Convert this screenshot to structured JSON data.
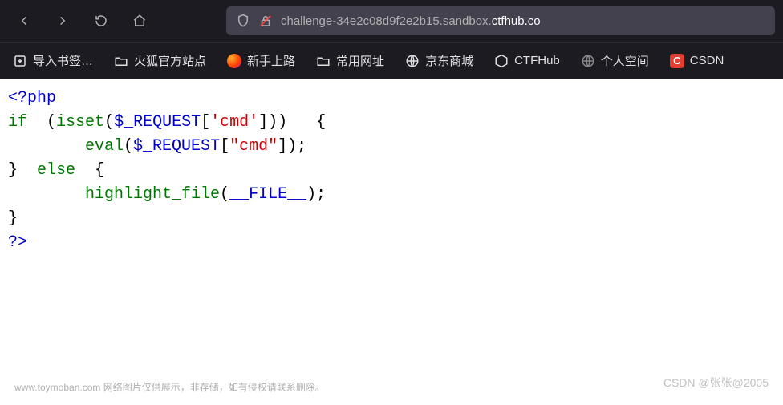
{
  "nav": {
    "url_prefix": "challenge-34e2c08d9f2e2b15.sandbox.",
    "url_bold": "ctfhub.co"
  },
  "bookmarks": [
    {
      "label": "导入书签…"
    },
    {
      "label": "火狐官方站点"
    },
    {
      "label": "新手上路"
    },
    {
      "label": "常用网址"
    },
    {
      "label": "京东商城"
    },
    {
      "label": "CTFHub"
    },
    {
      "label": "个人空间"
    },
    {
      "label": "CSDN",
      "short": "C"
    }
  ],
  "code": {
    "l1a": "<?php",
    "l2a": "if",
    "l2b": "  (",
    "l2c": "isset",
    "l2d": "(",
    "l2e": "$_REQUEST",
    "l2f": "[",
    "l2g": "'cmd'",
    "l2h": "]))   {",
    "l3a": "        eval",
    "l3b": "(",
    "l3c": "$_REQUEST",
    "l3d": "[",
    "l3e": "\"cmd\"",
    "l3f": "]);",
    "l4a": "}  ",
    "l4b": "else",
    "l4c": "  {",
    "l5a": "        ",
    "l5b": "highlight_file",
    "l5c": "(",
    "l5d": "__FILE__",
    "l5e": ");",
    "l6a": "}",
    "l7a": "?>"
  },
  "watermarks": {
    "left": "www.toymoban.com 网络图片仅供展示，非存储，如有侵权请联系删除。",
    "right": "CSDN @张张@2005"
  }
}
